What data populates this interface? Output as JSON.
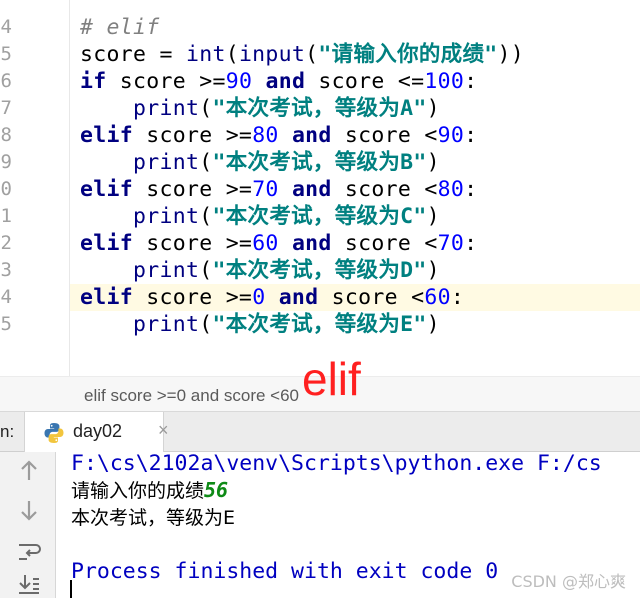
{
  "editor": {
    "line_numbers": [
      "4",
      "5",
      "6",
      "7",
      "8",
      "9",
      "0",
      "1",
      "2",
      "3",
      "4",
      "5"
    ],
    "lines": [
      [
        {
          "t": "# elif",
          "c": "cm"
        }
      ],
      [
        {
          "t": "score = ",
          "c": ""
        },
        {
          "t": "int",
          "c": "fn"
        },
        {
          "t": "(",
          "c": ""
        },
        {
          "t": "input",
          "c": "fn"
        },
        {
          "t": "(",
          "c": ""
        },
        {
          "t": "\"请输入你的成绩\"",
          "c": "str"
        },
        {
          "t": "))",
          "c": ""
        }
      ],
      [
        {
          "t": "if",
          "c": "kw"
        },
        {
          "t": " score >=",
          "c": ""
        },
        {
          "t": "90",
          "c": "num"
        },
        {
          "t": " ",
          "c": ""
        },
        {
          "t": "and",
          "c": "kw"
        },
        {
          "t": " score <=",
          "c": ""
        },
        {
          "t": "100",
          "c": "num"
        },
        {
          "t": ":",
          "c": ""
        }
      ],
      [
        {
          "t": "    ",
          "c": ""
        },
        {
          "t": "print",
          "c": "fn"
        },
        {
          "t": "(",
          "c": ""
        },
        {
          "t": "\"本次考试，等级为A\"",
          "c": "str"
        },
        {
          "t": ")",
          "c": ""
        }
      ],
      [
        {
          "t": "elif",
          "c": "kw"
        },
        {
          "t": " score >=",
          "c": ""
        },
        {
          "t": "80",
          "c": "num"
        },
        {
          "t": " ",
          "c": ""
        },
        {
          "t": "and",
          "c": "kw"
        },
        {
          "t": " score <",
          "c": ""
        },
        {
          "t": "90",
          "c": "num"
        },
        {
          "t": ":",
          "c": ""
        }
      ],
      [
        {
          "t": "    ",
          "c": ""
        },
        {
          "t": "print",
          "c": "fn"
        },
        {
          "t": "(",
          "c": ""
        },
        {
          "t": "\"本次考试，等级为B\"",
          "c": "str"
        },
        {
          "t": ")",
          "c": ""
        }
      ],
      [
        {
          "t": "elif",
          "c": "kw"
        },
        {
          "t": " score >=",
          "c": ""
        },
        {
          "t": "70",
          "c": "num"
        },
        {
          "t": " ",
          "c": ""
        },
        {
          "t": "and",
          "c": "kw"
        },
        {
          "t": " score <",
          "c": ""
        },
        {
          "t": "80",
          "c": "num"
        },
        {
          "t": ":",
          "c": ""
        }
      ],
      [
        {
          "t": "    ",
          "c": ""
        },
        {
          "t": "print",
          "c": "fn"
        },
        {
          "t": "(",
          "c": ""
        },
        {
          "t": "\"本次考试，等级为C\"",
          "c": "str"
        },
        {
          "t": ")",
          "c": ""
        }
      ],
      [
        {
          "t": "elif",
          "c": "kw"
        },
        {
          "t": " score >=",
          "c": ""
        },
        {
          "t": "60",
          "c": "num"
        },
        {
          "t": " ",
          "c": ""
        },
        {
          "t": "and",
          "c": "kw"
        },
        {
          "t": " score <",
          "c": ""
        },
        {
          "t": "70",
          "c": "num"
        },
        {
          "t": ":",
          "c": ""
        }
      ],
      [
        {
          "t": "    ",
          "c": ""
        },
        {
          "t": "print",
          "c": "fn"
        },
        {
          "t": "(",
          "c": ""
        },
        {
          "t": "\"本次考试，等级为D\"",
          "c": "str"
        },
        {
          "t": ")",
          "c": ""
        }
      ],
      [
        {
          "t": "elif",
          "c": "kw"
        },
        {
          "t": " score >=",
          "c": ""
        },
        {
          "t": "0",
          "c": "num"
        },
        {
          "t": " ",
          "c": ""
        },
        {
          "t": "and",
          "c": "kw"
        },
        {
          "t": " score <",
          "c": ""
        },
        {
          "t": "60",
          "c": "num"
        },
        {
          "t": ":",
          "c": ""
        }
      ],
      [
        {
          "t": "    ",
          "c": ""
        },
        {
          "t": "print",
          "c": "fn"
        },
        {
          "t": "(",
          "c": ""
        },
        {
          "t": "\"本次考试，等级为E\"",
          "c": "str"
        },
        {
          "t": ")",
          "c": ""
        }
      ]
    ],
    "highlighted_line_number": "4"
  },
  "breadcrumb": {
    "text": "elif score >=0 and score <60"
  },
  "overlay": {
    "text": "elif",
    "color": "#ff2020"
  },
  "run_panel": {
    "label": "n:",
    "tab_label": "day02",
    "tab_close": "×",
    "console": {
      "command": "F:\\cs\\2102a\\venv\\Scripts\\python.exe F:/cs",
      "prompt": "请输入你的成绩",
      "user_input": "56",
      "result": "本次考试，等级为E",
      "exit_message": "Process finished with exit code 0"
    }
  },
  "watermark": {
    "text": "CSDN @郑心爽"
  },
  "icons": [
    "python-icon",
    "up-arrow-icon",
    "down-arrow-icon",
    "soft-wrap-icon",
    "scroll-to-end-icon"
  ]
}
